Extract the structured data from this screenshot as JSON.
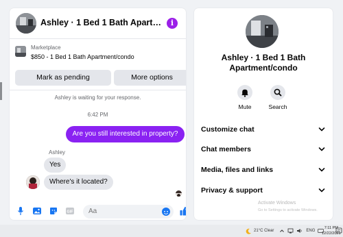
{
  "chat": {
    "title": "Ashley · 1 Bed 1 Bath Apartmen...",
    "marketplace_label": "Marketplace",
    "listing": "$850 - 1 Bed 1 Bath Apartment/condo",
    "mark_pending": "Mark as pending",
    "more_options": "More options",
    "waiting_text": "Ashley is waiting for your response.",
    "time": "6:42 PM",
    "outgoing_message": "Are you still interested in property?",
    "sender_name": "Ashley",
    "incoming_messages": [
      "Yes",
      "Where's it located?"
    ],
    "input_placeholder": "Aa",
    "composer_icons": [
      "microphone-icon",
      "photo-icon",
      "sticker-icon",
      "gif-icon",
      "emoji-icon",
      "like-icon"
    ]
  },
  "info": {
    "title": "Ashley · 1 Bed 1 Bath Apartment/condo",
    "actions": [
      {
        "label": "Mute",
        "icon": "bell-icon"
      },
      {
        "label": "Search",
        "icon": "search-icon"
      }
    ],
    "menu": [
      {
        "label": "Customize chat"
      },
      {
        "label": "Chat members"
      },
      {
        "label": "Media, files and links"
      },
      {
        "label": "Privacy & support"
      }
    ],
    "watermark_line1": "Activate Windows",
    "watermark_line2": "Go to Settings to activate Windows."
  },
  "taskbar": {
    "weather": "21°C  Clear",
    "language": "ENG",
    "time": "7:11 PM",
    "date": "12/22/2021"
  },
  "colors": {
    "accent": "#8a22f2",
    "messenger_blue": "#1876f2",
    "bubble_gray": "#e4e6eb"
  }
}
